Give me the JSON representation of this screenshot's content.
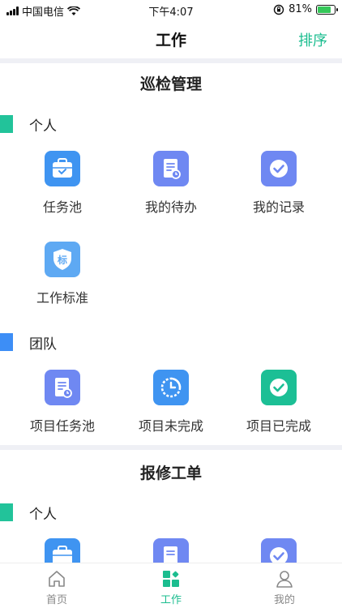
{
  "status_bar": {
    "carrier": "中国电信",
    "time": "下午4:07",
    "battery": "81%",
    "battery_level": 0.81,
    "icons": [
      "signal-icon",
      "wifi-icon",
      "orientation-lock-icon",
      "battery-icon"
    ]
  },
  "nav": {
    "title": "工作",
    "sort_label": "排序"
  },
  "colors": {
    "accent": "#1bbd8f",
    "bar_teal": "#22c39a",
    "bar_blue": "#3d8ef6",
    "icon_blue": "#3f94f1",
    "icon_lavender": "#6f88f2",
    "icon_shield": "#5ea9f3",
    "icon_green": "#1cbf95"
  },
  "sections": [
    {
      "title": "巡检管理",
      "groups": [
        {
          "label": "个人",
          "items": [
            {
              "label": "任务池",
              "icon": "briefcase-icon"
            },
            {
              "label": "我的待办",
              "icon": "todo-document-icon"
            },
            {
              "label": "我的记录",
              "icon": "check-record-icon"
            },
            {
              "label": "工作标准",
              "icon": "standard-shield-icon",
              "glyph": "标"
            }
          ]
        },
        {
          "label": "团队",
          "items": [
            {
              "label": "项目任务池",
              "icon": "project-document-icon"
            },
            {
              "label": "项目未完成",
              "icon": "pie-clock-icon"
            },
            {
              "label": "项目已完成",
              "icon": "completed-check-icon"
            }
          ]
        }
      ]
    },
    {
      "title": "报修工单",
      "groups": [
        {
          "label": "个人",
          "items": [
            {
              "label": "",
              "icon": "briefcase-icon"
            },
            {
              "label": "",
              "icon": "todo-document-icon"
            },
            {
              "label": "",
              "icon": "check-record-icon"
            }
          ]
        }
      ]
    }
  ],
  "tab_bar": {
    "items": [
      {
        "label": "首页",
        "icon": "home-icon",
        "active": false
      },
      {
        "label": "工作",
        "icon": "grid-icon",
        "active": true
      },
      {
        "label": "我的",
        "icon": "user-icon",
        "active": false
      }
    ]
  }
}
